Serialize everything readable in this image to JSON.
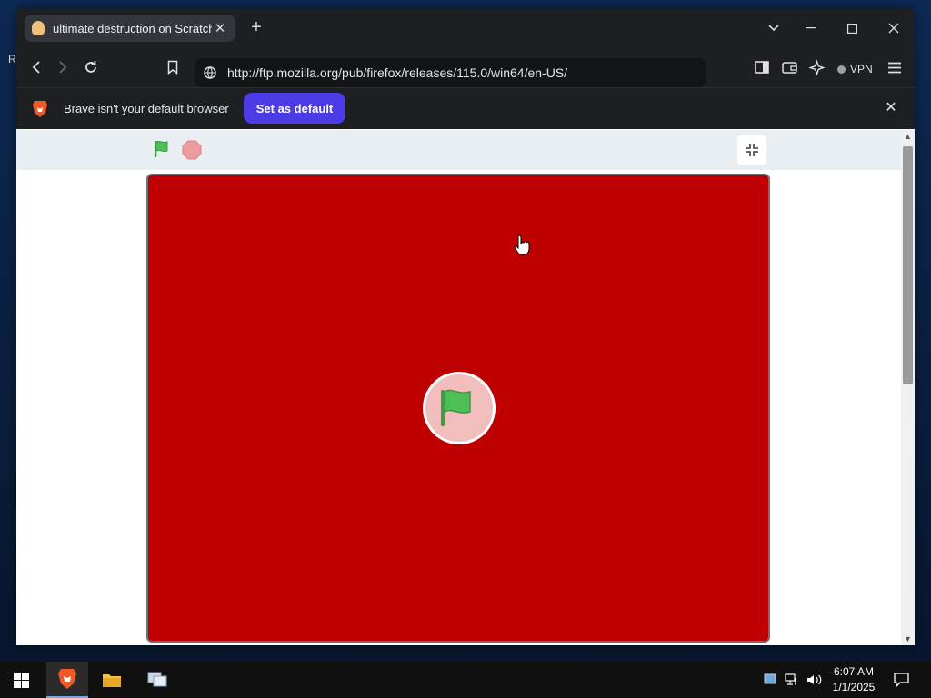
{
  "desktop": {
    "partial_label": "R"
  },
  "browser": {
    "tab": {
      "title": "ultimate destruction on Scratch",
      "close": "✕",
      "favicon": "scratch-favicon"
    },
    "new_tab": "+",
    "window_controls": {
      "dropdown": "chevron-down-icon",
      "minimize": "minimize-icon",
      "maximize": "maximize-icon",
      "close": "close-icon"
    },
    "address": {
      "url": "http://ftp.mozilla.org/pub/firefox/releases/115.0/win64/en-US/"
    },
    "vpn_label": "VPN"
  },
  "infobar": {
    "message": "Brave isn't your default browser",
    "button": "Set as default",
    "close": "✕"
  },
  "scratch": {
    "controls": [
      "green-flag-icon",
      "stop-icon",
      "unfullscreen-icon"
    ],
    "stage": {
      "background": "#be0000",
      "state": "not started"
    }
  },
  "taskbar": {
    "apps": [
      "brave-icon",
      "file-explorer-icon",
      "network-app-icon"
    ],
    "time": "6:07 AM",
    "date": "1/1/2025"
  },
  "colors": {
    "accent": "#4c3ce6",
    "stage": "#be0000",
    "chrome": "#1e1f22",
    "flag_green": "#4cbf56"
  }
}
